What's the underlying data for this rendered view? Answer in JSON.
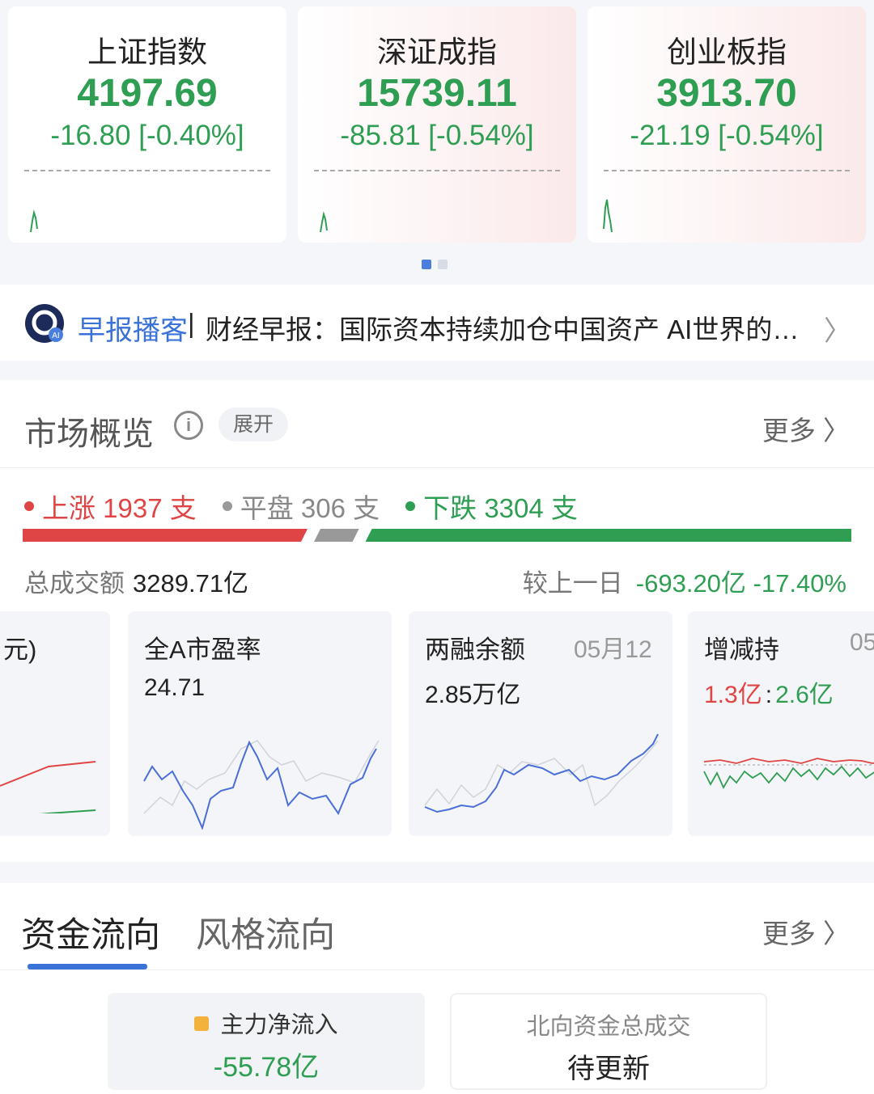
{
  "indices": [
    {
      "name": "上证指数",
      "value": "4197.69",
      "change": "-16.80 [-0.40%]"
    },
    {
      "name": "深证成指",
      "value": "15739.11",
      "change": "-85.81 [-0.54%]"
    },
    {
      "name": "创业板指",
      "value": "3913.70",
      "change": "-21.19 [-0.54%]"
    }
  ],
  "news": {
    "logo_badge": "AI",
    "tag": "早报播客",
    "separator": "|",
    "text": "财经早报：国际资本持续加仓中国资产 AI世界的…"
  },
  "market": {
    "title": "市场概览",
    "expand_label": "展开",
    "more_label": "更多",
    "up_text": "上涨 1937 支",
    "flat_text": "平盘 306 支",
    "down_text": "下跌 3304 支",
    "up_count": 1937,
    "flat_count": 306,
    "down_count": 3304,
    "turnover_label": "总成交额",
    "turnover_value": "3289.71亿",
    "compare_label": "较上一日",
    "compare_value": "-693.20亿 -17.40%",
    "cards": [
      {
        "title": "元)",
        "date": "",
        "value": ""
      },
      {
        "title": "全A市盈率",
        "date": "",
        "value": "24.71"
      },
      {
        "title": "两融余额",
        "date": "05月12",
        "value": "2.85万亿"
      },
      {
        "title": "增减持",
        "date": "05",
        "value_red": "1.3亿",
        "value_sep": ":",
        "value_green": "2.6亿"
      }
    ]
  },
  "flow": {
    "tab_active": "资金流向",
    "tab_other": "风格流向",
    "more_label": "更多",
    "main_label": "主力净流入",
    "main_value": "-55.78亿",
    "north_label": "北向资金总成交",
    "north_value": "待更新"
  },
  "colors": {
    "up": "#e04545",
    "down": "#2e9e52",
    "accent": "#3a72d8"
  }
}
